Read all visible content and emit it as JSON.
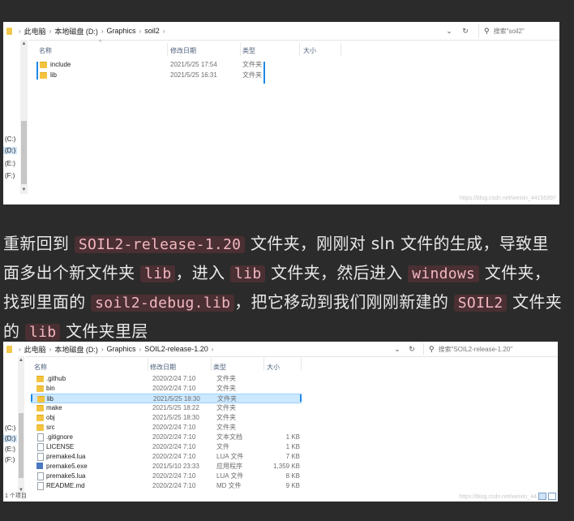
{
  "explorer_top": {
    "breadcrumb": [
      "此电脑",
      "本地磁盘 (D:)",
      "Graphics",
      "soil2"
    ],
    "search_placeholder": "搜索\"soil2\"",
    "columns": {
      "name": "名称",
      "date": "修改日期",
      "type": "类型",
      "size": "大小"
    },
    "drives": [
      "(C:)",
      "(D:)",
      "(E:)",
      "(F:)"
    ],
    "selected_drive_index": 1,
    "files": [
      {
        "name": "include",
        "date": "2021/5/25 17:54",
        "type": "文件夹",
        "size": "",
        "icon": "folder-icon"
      },
      {
        "name": "lib",
        "date": "2021/5/25 16:31",
        "type": "文件夹",
        "size": "",
        "icon": "folder-icon"
      }
    ],
    "watermark": "https://blog.csdn.net/weixin_44155997"
  },
  "paragraph": {
    "t1": "重新回到 ",
    "c1": "SOIL2-release-1.20",
    "t2": " 文件夹，刚刚对 sln 文件的生成，导致里面多出个新文件夹 ",
    "c2": "lib",
    "t3": "，进入 ",
    "c3": "lib",
    "t4": " 文件夹，然后进入 ",
    "c4": "windows",
    "t5": " 文件夹，找到里面的 ",
    "c5": "soil2-debug.lib",
    "t6": "，把它移动到我们刚刚新建的 ",
    "c6": "SOIL2",
    "t7": " 文件夹的 ",
    "c7": "lib",
    "t8": " 文件夹里层"
  },
  "explorer_bottom": {
    "breadcrumb": [
      "此电脑",
      "本地磁盘 (D:)",
      "Graphics",
      "SOIL2-release-1.20"
    ],
    "search_placeholder": "搜索\"SOIL2-release-1.20\"",
    "columns": {
      "name": "名称",
      "date": "修改日期",
      "type": "类型",
      "size": "大小"
    },
    "drives": [
      "(C:)",
      "(D:)",
      "(E:)",
      "(F:)"
    ],
    "selected_drive_index": 1,
    "files": [
      {
        "name": ".github",
        "date": "2020/2/24 7:10",
        "type": "文件夹",
        "size": "",
        "icon": "folder-icon"
      },
      {
        "name": "bin",
        "date": "2020/2/24 7:10",
        "type": "文件夹",
        "size": "",
        "icon": "folder-icon"
      },
      {
        "name": "lib",
        "date": "2021/5/25 18:30",
        "type": "文件夹",
        "size": "",
        "icon": "folder-icon"
      },
      {
        "name": "make",
        "date": "2021/5/25 18:22",
        "type": "文件夹",
        "size": "",
        "icon": "folder-icon"
      },
      {
        "name": "obj",
        "date": "2021/5/25 18:30",
        "type": "文件夹",
        "size": "",
        "icon": "folder-icon"
      },
      {
        "name": "src",
        "date": "2020/2/24 7:10",
        "type": "文件夹",
        "size": "",
        "icon": "folder-icon"
      },
      {
        "name": ".gitignore",
        "date": "2020/2/24 7:10",
        "type": "文本文档",
        "size": "1 KB",
        "icon": "text-file-icon"
      },
      {
        "name": "LICENSE",
        "date": "2020/2/24 7:10",
        "type": "文件",
        "size": "1 KB",
        "icon": "file-icon"
      },
      {
        "name": "premake4.lua",
        "date": "2020/2/24 7:10",
        "type": "LUA 文件",
        "size": "7 KB",
        "icon": "lua-file-icon"
      },
      {
        "name": "premake5.exe",
        "date": "2021/5/10 23:33",
        "type": "应用程序",
        "size": "1,359 KB",
        "icon": "exe-icon"
      },
      {
        "name": "premake5.lua",
        "date": "2020/2/24 7:10",
        "type": "LUA 文件",
        "size": "8 KB",
        "icon": "lua-file-icon"
      },
      {
        "name": "README.md",
        "date": "2020/2/24 7:10",
        "type": "MD 文件",
        "size": "9 KB",
        "icon": "md-file-icon"
      }
    ],
    "selected_file_index": 2,
    "status": "1 个项目",
    "watermark": "https://blog.csdn.net/weixin_44"
  }
}
